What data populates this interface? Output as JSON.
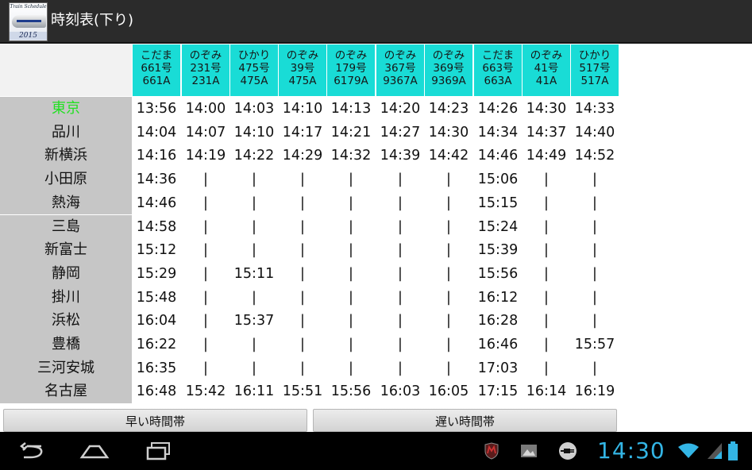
{
  "app": {
    "title": "時刻表(下り)",
    "icon_text_top": "Train Schedule",
    "icon_text_year": "2015"
  },
  "colors": {
    "header_bg": "#19dcd6",
    "station_bg": "#c6c6c6",
    "active_station": "#22e022",
    "clock": "#33b5e5"
  },
  "trains": [
    {
      "type": "こだま",
      "number": "661号",
      "code": "661A"
    },
    {
      "type": "のぞみ",
      "number": "231号",
      "code": "231A"
    },
    {
      "type": "ひかり",
      "number": "475号",
      "code": "475A"
    },
    {
      "type": "のぞみ",
      "number": "39号",
      "code": "475A"
    },
    {
      "type": "のぞみ",
      "number": "179号",
      "code": "6179A"
    },
    {
      "type": "のぞみ",
      "number": "367号",
      "code": "9367A"
    },
    {
      "type": "のぞみ",
      "number": "369号",
      "code": "9369A"
    },
    {
      "type": "こだま",
      "number": "663号",
      "code": "663A"
    },
    {
      "type": "のぞみ",
      "number": "41号",
      "code": "41A"
    },
    {
      "type": "ひかり",
      "number": "517号",
      "code": "517A"
    }
  ],
  "rows": [
    {
      "station": "東京",
      "active": true,
      "times": [
        "13:56",
        "14:00",
        "14:03",
        "14:10",
        "14:13",
        "14:20",
        "14:23",
        "14:26",
        "14:30",
        "14:33"
      ]
    },
    {
      "station": "品川",
      "times": [
        "14:04",
        "14:07",
        "14:10",
        "14:17",
        "14:21",
        "14:27",
        "14:30",
        "14:34",
        "14:37",
        "14:40"
      ]
    },
    {
      "station": "新横浜",
      "times": [
        "14:16",
        "14:19",
        "14:22",
        "14:29",
        "14:32",
        "14:39",
        "14:42",
        "14:46",
        "14:49",
        "14:52"
      ]
    },
    {
      "station": "小田原",
      "times": [
        "14:36",
        "|",
        "|",
        "|",
        "|",
        "|",
        "|",
        "15:06",
        "|",
        "|"
      ]
    },
    {
      "station": "熱海",
      "times": [
        "14:46",
        "|",
        "|",
        "|",
        "|",
        "|",
        "|",
        "15:15",
        "|",
        "|"
      ]
    },
    {
      "station": "三島",
      "times": [
        "14:58",
        "|",
        "|",
        "|",
        "|",
        "|",
        "|",
        "15:24",
        "|",
        "|"
      ]
    },
    {
      "station": "新富士",
      "times": [
        "15:12",
        "|",
        "|",
        "|",
        "|",
        "|",
        "|",
        "15:39",
        "|",
        "|"
      ]
    },
    {
      "station": "静岡",
      "times": [
        "15:29",
        "|",
        "15:11",
        "|",
        "|",
        "|",
        "|",
        "15:56",
        "|",
        "|"
      ]
    },
    {
      "station": "掛川",
      "times": [
        "15:48",
        "|",
        "|",
        "|",
        "|",
        "|",
        "|",
        "16:12",
        "|",
        "|"
      ]
    },
    {
      "station": "浜松",
      "times": [
        "16:04",
        "|",
        "15:37",
        "|",
        "|",
        "|",
        "|",
        "16:28",
        "|",
        "|"
      ]
    },
    {
      "station": "豊橋",
      "times": [
        "16:22",
        "|",
        "|",
        "|",
        "|",
        "|",
        "|",
        "16:46",
        "|",
        "15:57"
      ]
    },
    {
      "station": "三河安城",
      "times": [
        "16:35",
        "|",
        "|",
        "|",
        "|",
        "|",
        "|",
        "17:03",
        "|",
        "|"
      ]
    },
    {
      "station": "名古屋",
      "times": [
        "16:48",
        "15:42",
        "16:11",
        "15:51",
        "15:56",
        "16:03",
        "16:05",
        "17:15",
        "16:14",
        "16:19"
      ]
    }
  ],
  "buttons": {
    "earlier": "早い時間帯",
    "later": "遅い時間帯"
  },
  "statusbar": {
    "time": "14:30"
  }
}
